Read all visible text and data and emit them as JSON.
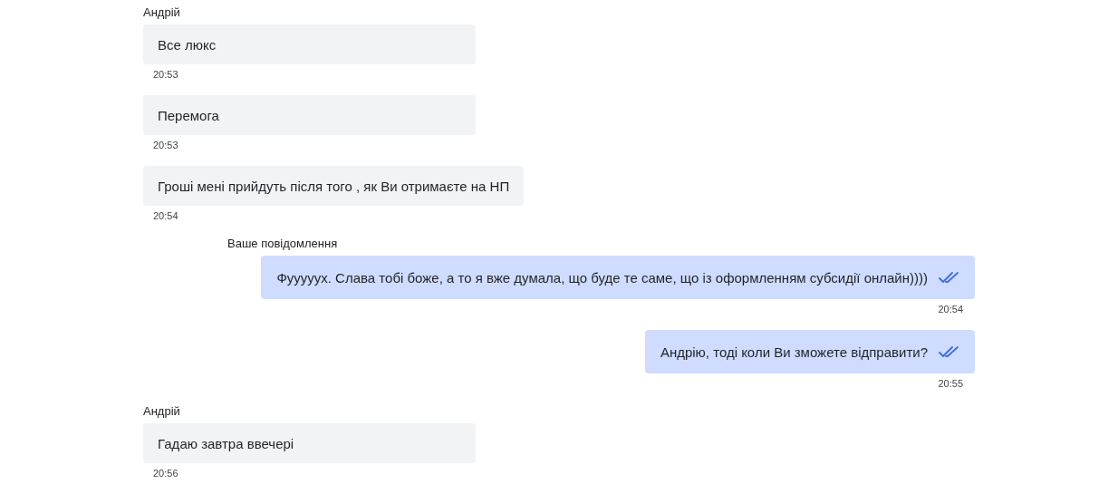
{
  "messages": [
    {
      "kind": "incoming",
      "sender": "Андрій",
      "text": "Все люкс",
      "time": "20:53"
    },
    {
      "kind": "incoming",
      "text": "Перемога",
      "time": "20:53"
    },
    {
      "kind": "incoming",
      "text": "Гроші мені прийдуть після того , як Ви отримаєте на НП",
      "time": "20:54"
    },
    {
      "kind": "outgoing",
      "sender": "Ваше повідомлення",
      "text": "Фууууух. Слава тобі боже, а то я вже думала, що буде те саме, що із оформленням субсидії онлайн))))",
      "time": "20:54",
      "read": true
    },
    {
      "kind": "outgoing",
      "text": "Андрію, тоді коли Ви зможете відправити?",
      "time": "20:55",
      "read": true
    },
    {
      "kind": "incoming",
      "sender": "Андрій",
      "text": "Гадаю завтра ввечері",
      "time": "20:56"
    }
  ]
}
